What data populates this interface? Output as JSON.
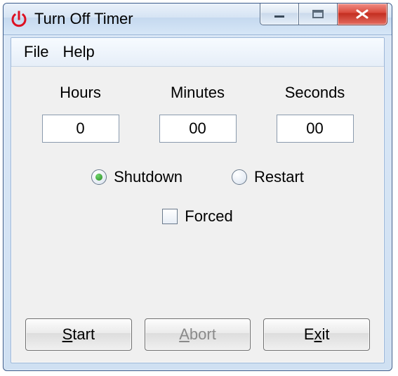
{
  "window": {
    "title": "Turn Off Timer"
  },
  "menu": {
    "file": "File",
    "help": "Help"
  },
  "time": {
    "hours_label": "Hours",
    "minutes_label": "Minutes",
    "seconds_label": "Seconds",
    "hours_value": "0",
    "minutes_value": "00",
    "seconds_value": "00"
  },
  "options": {
    "shutdown_label": "Shutdown",
    "restart_label": "Restart",
    "forced_label": "Forced",
    "selected": "shutdown",
    "forced_checked": false
  },
  "buttons": {
    "start_char": "S",
    "start_rest": "tart",
    "abort_char": "A",
    "abort_rest": "bort",
    "exit_char": "x",
    "exit_pre": "E",
    "exit_post": "it",
    "abort_enabled": false
  }
}
